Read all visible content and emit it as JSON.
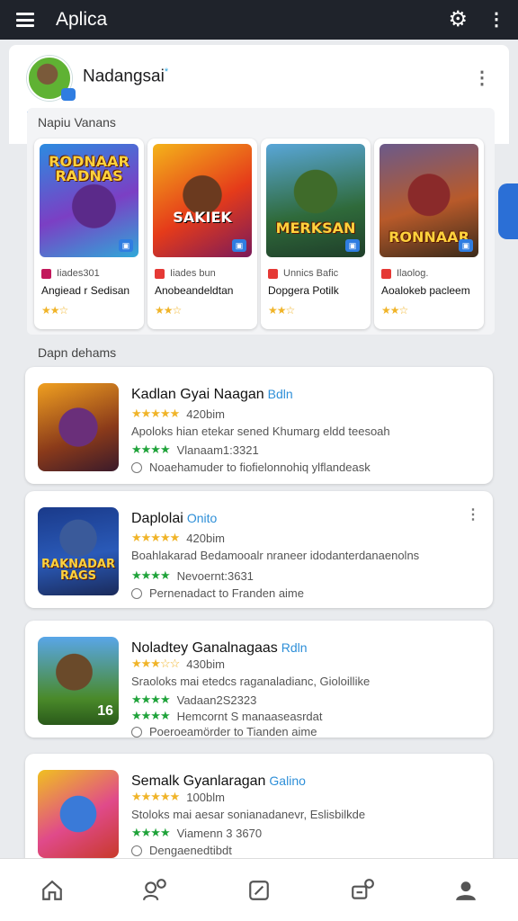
{
  "appbar": {
    "title": "Aplica",
    "icons": [
      "menu-icon",
      "gear-icon",
      "more-vertical-icon"
    ]
  },
  "profile": {
    "name": "Nadangsai",
    "name_mark": "*"
  },
  "featured": {
    "label": "Napiu Vanans",
    "cards": [
      {
        "logo": "RODNAAR RADNAS",
        "meta": "Iiades301",
        "title": "Angiead r Sedisan",
        "stars": "★★☆",
        "color": "#c2185b"
      },
      {
        "logo": "SAKIEK",
        "meta": "Iiades bun",
        "title": "Anobeandeldtan",
        "stars": "★★☆",
        "color": "#e53935"
      },
      {
        "logo": "MERKSAN",
        "meta": "Unnics Bafic",
        "title": "Dopgera Potilk",
        "stars": "★★☆",
        "color": "#e53935"
      },
      {
        "logo": "RONNAAR",
        "meta": "Ilaolog.",
        "title": "Aoalokeb pacleem",
        "stars": "★★☆",
        "color": "#e53935"
      }
    ]
  },
  "list": {
    "label": "Dapn dehams",
    "items": [
      {
        "title": "Kadlan Gyai Naagan",
        "tag": "Bdln",
        "stars": "★★★★★",
        "count": "420bim",
        "desc": "Apoloks hian etekar sened Khumarg eldd teesoah",
        "stars2": "★★★★",
        "sub": "Vlanaam1:3321",
        "note": "Noaehamuder to fiofielonnohiq ylflandeask",
        "has_kebab": false,
        "logo": "",
        "num": ""
      },
      {
        "title": "Daplolai",
        "tag": "Onito",
        "stars": "★★★★★",
        "count": "420bim",
        "desc": "Boahlakarad Bedamooalr nraneer idodanterdanaenolns",
        "stars2": "★★★★",
        "sub": "Nevoernt:3631",
        "note": "Pernenadact to Franden aime",
        "has_kebab": true,
        "logo": "RAKNADAR RAGS",
        "num": ""
      },
      {
        "title": "Noladtey Ganalnagaas",
        "tag": "Rdln",
        "stars": "★★★☆☆",
        "count": "430bim",
        "desc": "Sraoloks mai etedcs raganaladianc, Gioloillike",
        "stars2": "★★★★",
        "sub": "Vadaan2S2323",
        "note": "Poeroeamörder to Tianden aime",
        "extra_stars": "★★★★",
        "extra": "Hemcornt S  manaaseasrdat",
        "has_kebab": false,
        "logo": "",
        "num": "16"
      },
      {
        "title": "Semalk Gyanlaragan",
        "tag": "Galino",
        "stars": "★★★★★",
        "count": "100blm",
        "desc": "Stoloks mai aesar sonianadanevr, Eslisbilkde",
        "stars2": "★★★★",
        "sub": "Viamenn 3 3670",
        "note": "Dengaenedtibdt",
        "has_kebab": false,
        "logo": "",
        "num": ""
      }
    ]
  },
  "bottomnav": [
    "home-icon",
    "people-icon",
    "edit-icon",
    "notifications-icon",
    "profile-icon"
  ]
}
